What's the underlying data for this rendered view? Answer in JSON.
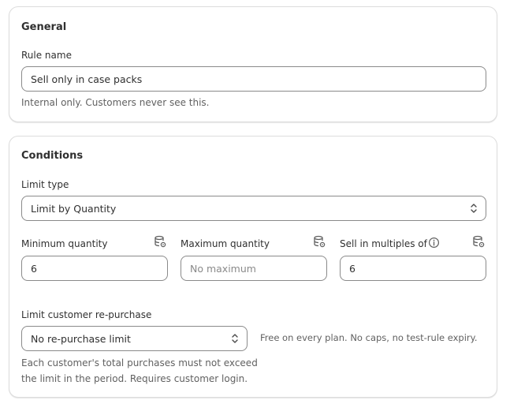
{
  "general": {
    "title": "General",
    "rule_name_label": "Rule name",
    "rule_name_value": "Sell only in case packs",
    "rule_name_help": "Internal only. Customers never see this."
  },
  "conditions": {
    "title": "Conditions",
    "limit_type_label": "Limit type",
    "limit_type_value": "Limit by Quantity",
    "min_label": "Minimum quantity",
    "min_value": "6",
    "max_label": "Maximum quantity",
    "max_placeholder": "No maximum",
    "max_value": "",
    "multiples_label": "Sell in multiples of",
    "multiples_value": "6",
    "repurchase_label": "Limit customer re-purchase",
    "repurchase_value": "No re-purchase limit",
    "repurchase_note": "Free on every plan. No caps, no test-rule expiry.",
    "repurchase_help_line1": "Each customer's total purchases must not exceed",
    "repurchase_help_line2": "the limit in the period. Requires customer login."
  },
  "icons": {
    "metafield": "database-settings-icon",
    "info": "info-icon",
    "select": "chevron-up-down-icon"
  }
}
